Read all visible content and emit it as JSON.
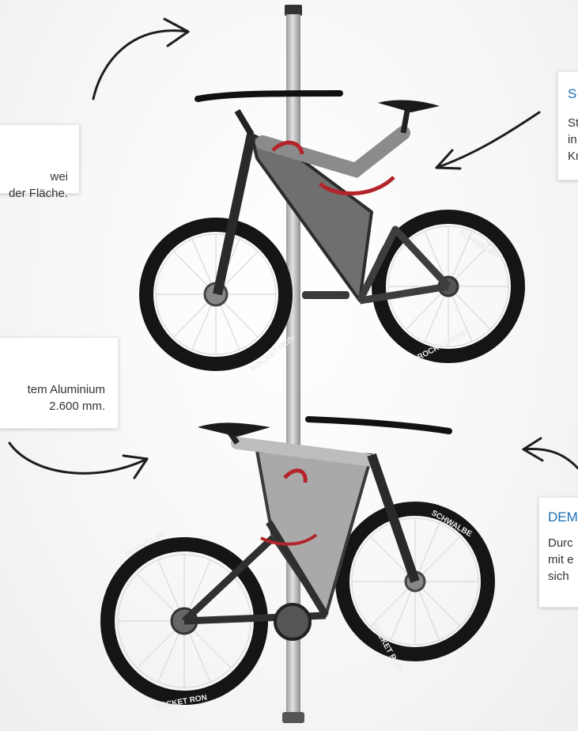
{
  "callouts": [
    {
      "id": "c1",
      "title": "",
      "lines": [
        "wei",
        "der Fläche."
      ]
    },
    {
      "id": "c2",
      "title": "",
      "lines": [
        "tem Aluminium",
        "2.600 mm."
      ]
    },
    {
      "id": "c3",
      "title": "S",
      "lines": [
        "St",
        "in",
        "Kr"
      ]
    },
    {
      "id": "c4",
      "title": "DEM",
      "lines": [
        "Durc",
        "mit e",
        "sich"
      ]
    }
  ],
  "tire_brand": "SCHWALBE",
  "tire_model": "ROCKET RON",
  "colors": {
    "accent_blue": "#1a6eb5",
    "frame_dark": "#3a3a3a",
    "frame_light": "#a8a8a8",
    "accent_red": "#b3252a",
    "pole": "#c9c9c9"
  }
}
